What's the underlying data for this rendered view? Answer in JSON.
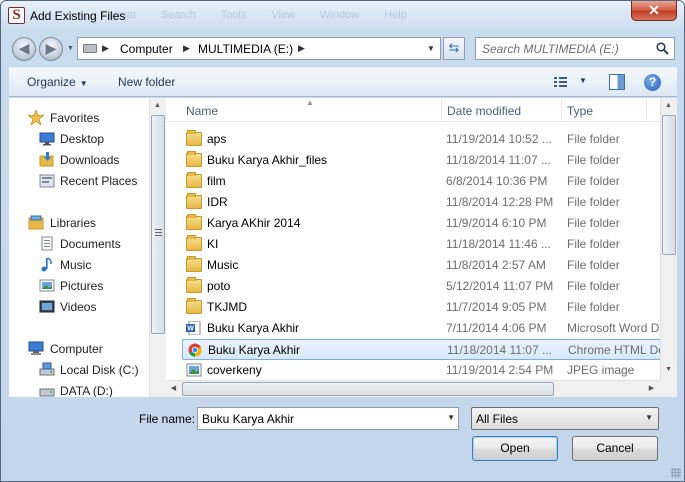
{
  "window": {
    "title": "Add Existing Files",
    "app_icon_letter": "S",
    "ghost_menu": "Format Search Tools View Window Help",
    "close_label": "✕"
  },
  "address_bar": {
    "segments": [
      "Computer",
      "MULTIMEDIA (E:)"
    ],
    "search_placeholder": "Search MULTIMEDIA (E:)"
  },
  "toolbar": {
    "organize_label": "Organize",
    "new_folder_label": "New folder",
    "help_label": "?"
  },
  "sidebar": {
    "groups": [
      {
        "label": "Favorites",
        "icon": "star-icon",
        "items": [
          {
            "label": "Desktop",
            "icon": "desktop-icon"
          },
          {
            "label": "Downloads",
            "icon": "downloads-icon"
          },
          {
            "label": "Recent Places",
            "icon": "recent-places-icon"
          }
        ]
      },
      {
        "label": "Libraries",
        "icon": "libraries-icon",
        "items": [
          {
            "label": "Documents",
            "icon": "documents-icon"
          },
          {
            "label": "Music",
            "icon": "music-icon"
          },
          {
            "label": "Pictures",
            "icon": "pictures-icon"
          },
          {
            "label": "Videos",
            "icon": "videos-icon"
          }
        ]
      },
      {
        "label": "Computer",
        "icon": "computer-icon",
        "items": [
          {
            "label": "Local Disk (C:)",
            "icon": "local-disk-icon"
          },
          {
            "label": "DATA (D:)",
            "icon": "drive-icon"
          }
        ]
      }
    ]
  },
  "file_list": {
    "columns": [
      "Name",
      "Date modified",
      "Type"
    ],
    "rows": [
      {
        "name": "aps",
        "date": "11/19/2014 10:52 ...",
        "type": "File folder",
        "icon": "folder-icon"
      },
      {
        "name": "Buku Karya Akhir_files",
        "date": "11/18/2014 11:07 ...",
        "type": "File folder",
        "icon": "folder-icon"
      },
      {
        "name": "film",
        "date": "6/8/2014 10:36 PM",
        "type": "File folder",
        "icon": "folder-icon"
      },
      {
        "name": "IDR",
        "date": "11/8/2014 12:28 PM",
        "type": "File folder",
        "icon": "folder-icon"
      },
      {
        "name": "Karya AKhir 2014",
        "date": "11/9/2014 6:10 PM",
        "type": "File folder",
        "icon": "folder-icon"
      },
      {
        "name": "KI",
        "date": "11/18/2014 11:46 ...",
        "type": "File folder",
        "icon": "folder-icon"
      },
      {
        "name": "Music",
        "date": "11/8/2014 2:57 AM",
        "type": "File folder",
        "icon": "folder-icon"
      },
      {
        "name": "poto",
        "date": "5/12/2014 11:07 PM",
        "type": "File folder",
        "icon": "folder-icon"
      },
      {
        "name": "TKJMD",
        "date": "11/7/2014 9:05 PM",
        "type": "File folder",
        "icon": "folder-icon"
      },
      {
        "name": "Buku Karya Akhir",
        "date": "7/11/2014 4:06 PM",
        "type": "Microsoft Word D",
        "icon": "word-document-icon"
      },
      {
        "name": "Buku Karya Akhir",
        "date": "11/18/2014 11:07 ...",
        "type": "Chrome HTML Do",
        "icon": "chrome-html-icon",
        "selected": true
      },
      {
        "name": "coverkeny",
        "date": "11/19/2014 2:54 PM",
        "type": "JPEG image",
        "icon": "jpeg-image-icon"
      }
    ]
  },
  "footer": {
    "file_name_label": "File name:",
    "file_name_value": "Buku Karya Akhir",
    "filter_value": "All Files",
    "open_label": "Open",
    "cancel_label": "Cancel"
  },
  "colors": {
    "selection_border": "#84acdd",
    "column_header_text": "#4c607a",
    "secondary_text": "#6d6d6d"
  }
}
